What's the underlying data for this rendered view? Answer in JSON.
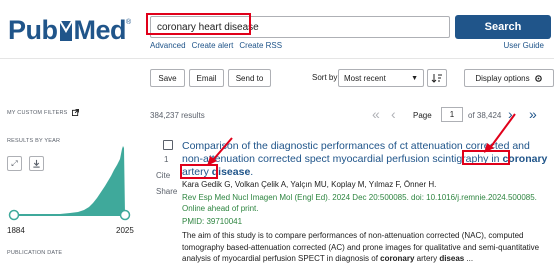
{
  "header": {
    "logo_text_1": "Pub",
    "logo_text_2": "Med",
    "logo_reg": "®",
    "search_value": "coronary heart disease",
    "search_button": "Search",
    "links": [
      "Advanced",
      "Create alert",
      "Create RSS"
    ],
    "user_guide": "User Guide"
  },
  "toolbar": {
    "save": "Save",
    "email": "Email",
    "send_to": "Send to",
    "sort_label": "Sort by:",
    "sort_value": "Most recent",
    "display_options": "Display options"
  },
  "sidebar": {
    "custom_filters": "MY CUSTOM FILTERS",
    "results_by_year": "RESULTS BY YEAR",
    "year_start": "1884",
    "year_end": "2025",
    "publication_date": "PUBLICATION DATE"
  },
  "results": {
    "count": "384,237 results",
    "page_label": "Page",
    "page_value": "1",
    "page_of": "of 38,424"
  },
  "article": {
    "number": "1",
    "cite": "Cite",
    "share": "Share",
    "title_part1": "Comparison of the diagnostic performances of ct attenuation corrected and non-attenuation corrected spect myocardial perfusion scintigraphy in ",
    "title_bold1": "coronary",
    "title_part2": " artery ",
    "title_bold2": "disease",
    "title_end": ".",
    "authors": "Kara Gedik G, Volkan Çelik A, Yalçın MU, Koplay M, Yılmaz F, Önner H.",
    "journal": "Rev Esp Med Nucl Imagen Mol (Engl Ed). 2024 Dec 20:500085. doi: 10.1016/j.remnie.2024.500085. Online ahead of print.",
    "pmid": "PMID: 39710041",
    "abstract_part1": "The aim of this study is to compare performances of non-attenuation corrected (NAC), computed tomography based-attenuation corrected (AC) and prone images for qualitative and semi-quantitative analysis of myocardial perfusion SPECT in diagnosis of ",
    "abstract_bold1": "coronary",
    "abstract_part2": " artery ",
    "abstract_bold2": "diseas",
    "abstract_end": " ..."
  },
  "colors": {
    "brand": "#20558a",
    "highlight": "#e0001a",
    "journal": "#2e8540",
    "chart": "#3fa99b"
  }
}
